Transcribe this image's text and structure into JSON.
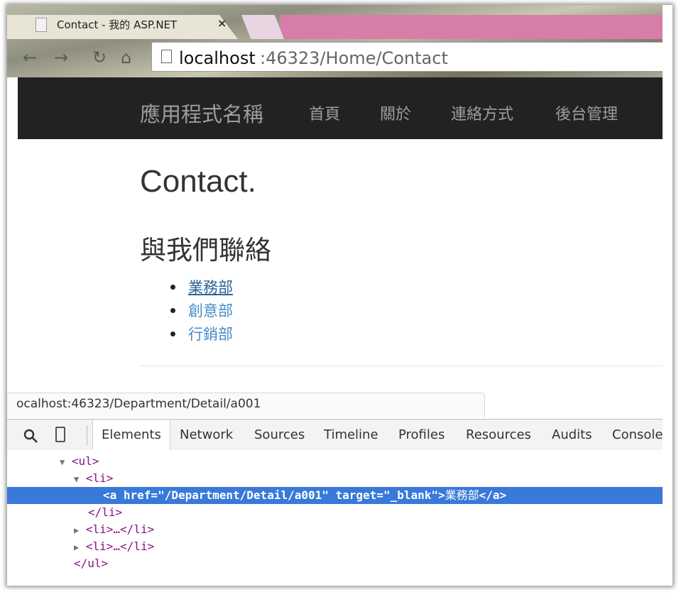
{
  "browser": {
    "tab_title": "Contact - 我的 ASP.NET",
    "tab_close": "×",
    "url_host": "localhost",
    "url_path": ":46323/Home/Contact",
    "nav_icons": [
      "back-arrow-icon",
      "forward-arrow-icon",
      "reload-icon",
      "home-icon"
    ]
  },
  "navbar": {
    "brand": "應用程式名稱",
    "links": [
      "首頁",
      "關於",
      "連絡方式",
      "後台管理"
    ]
  },
  "page": {
    "heading": "Contact.",
    "subheading": "與我們聯絡",
    "departments": [
      "業務部",
      "創意部",
      "行銷部"
    ],
    "hovered_index": 0
  },
  "status_bar": {
    "url": "ocalhost:46323/Department/Detail/a001"
  },
  "devtools": {
    "tabs": [
      "Elements",
      "Network",
      "Sources",
      "Timeline",
      "Profiles",
      "Resources",
      "Audits",
      "Console"
    ],
    "active_tab": "Elements",
    "dom_lines": {
      "ul_open": "<ul>",
      "li_open": "<li>",
      "anchor_open": "<a href=\"/Department/Detail/a001\" target=\"_blank\">",
      "anchor_text": "業務部",
      "anchor_close": "</a>",
      "li_close": "</li>",
      "li_collapsed_1": "<li>…</li>",
      "li_collapsed_2": "<li>…</li>",
      "ul_close": "</ul>"
    }
  },
  "colors": {
    "navbar_bg": "#222222",
    "navbar_text": "#9d9d9d",
    "link": "#428bca",
    "selection": "#3879d9",
    "tag": "#881280"
  }
}
